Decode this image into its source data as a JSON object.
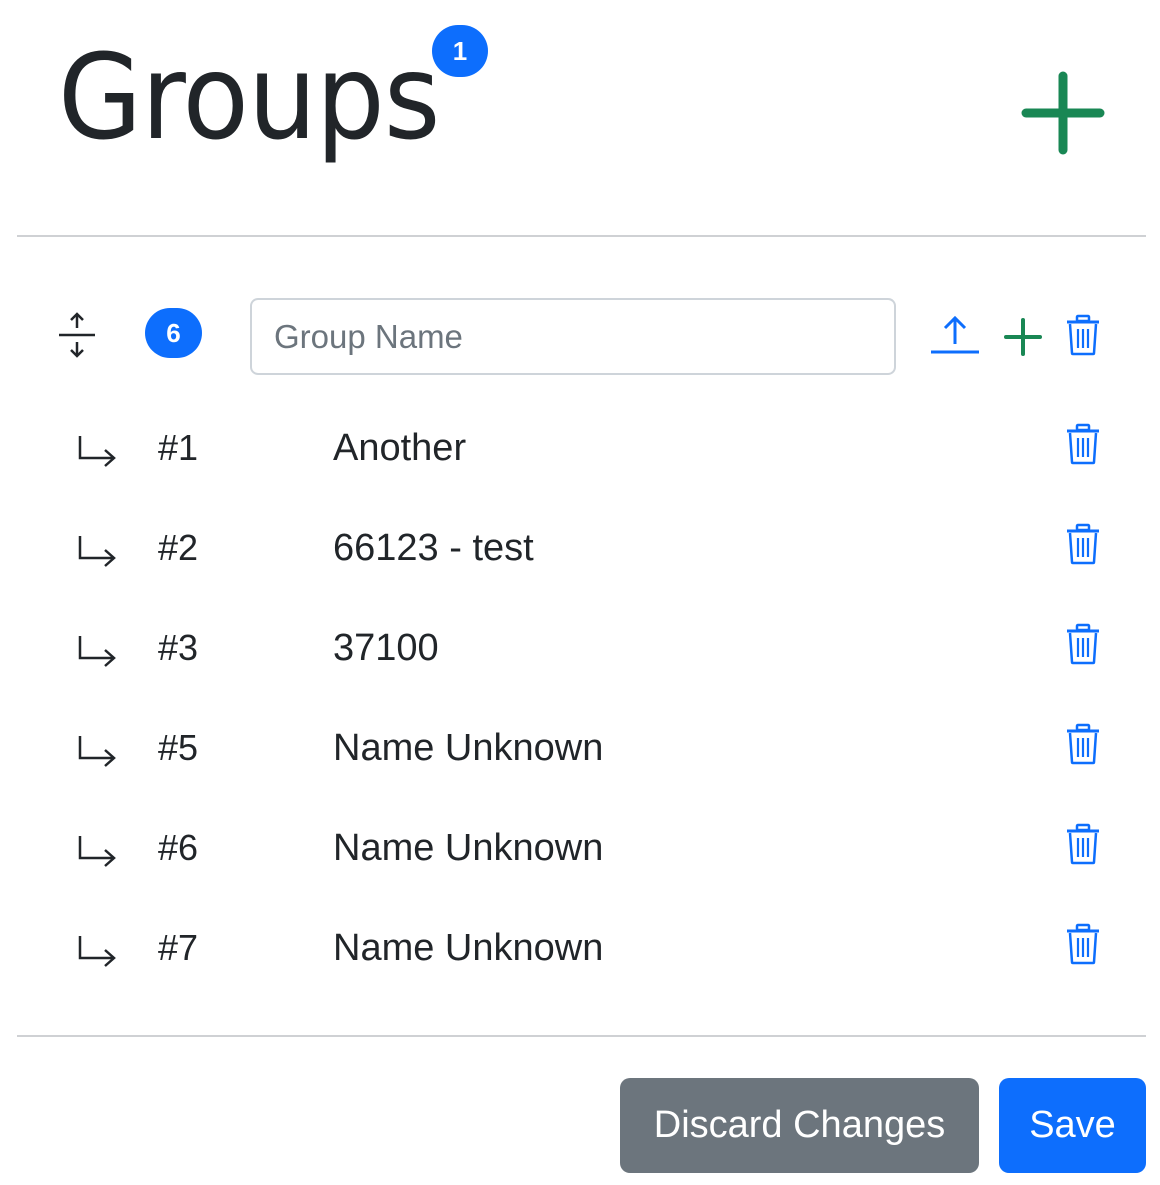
{
  "header": {
    "title": "Groups",
    "badge": "1",
    "add_icon": "plus-icon"
  },
  "group": {
    "count_badge": "6",
    "name_placeholder": "Group Name",
    "name_value": "",
    "icons": [
      "expand-vertical-icon",
      "upload-icon",
      "plus-icon",
      "trash-icon"
    ]
  },
  "members": [
    {
      "id": "#1",
      "name": "Another"
    },
    {
      "id": "#2",
      "name": "66123 - test"
    },
    {
      "id": "#3",
      "name": "37100"
    },
    {
      "id": "#5",
      "name": "Name Unknown"
    },
    {
      "id": "#6",
      "name": "Name Unknown"
    },
    {
      "id": "#7",
      "name": "Name Unknown"
    }
  ],
  "footer": {
    "discard_label": "Discard Changes",
    "save_label": "Save"
  },
  "colors": {
    "primary": "#0d6efd",
    "success": "#198754",
    "secondary": "#6c757d",
    "text": "#212529",
    "border": "#ced4da"
  }
}
